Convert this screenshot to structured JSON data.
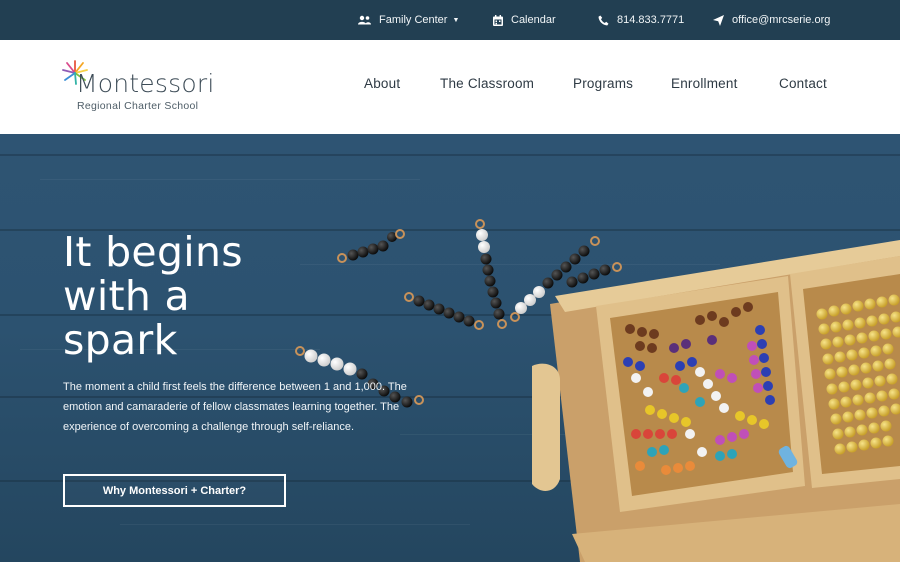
{
  "topbar": {
    "family_center": "Family Center",
    "calendar": "Calendar",
    "phone": "814.833.7771",
    "email": "office@mrcserie.org"
  },
  "logo": {
    "name": "Montessori",
    "subtitle": "Regional Charter School"
  },
  "nav": {
    "items": [
      "About",
      "The Classroom",
      "Programs",
      "Enrollment",
      "Contact"
    ]
  },
  "hero": {
    "title_lines": [
      "It begins",
      "with a",
      "spark"
    ],
    "body": "The moment a child first feels the difference between 1 and 1,000. The emotion and camaraderie of fellow classmates learning together. The experience of overcoming a challenge through self-reliance.",
    "button": "Why Montessori + Charter?"
  },
  "colors": {
    "topbar": "#223f52",
    "hero_bg": "#2e5473",
    "nav_text": "#2e3a44"
  },
  "icons": [
    "users-icon",
    "calendar-icon",
    "phone-icon",
    "send-icon",
    "sunburst-logo-icon"
  ]
}
